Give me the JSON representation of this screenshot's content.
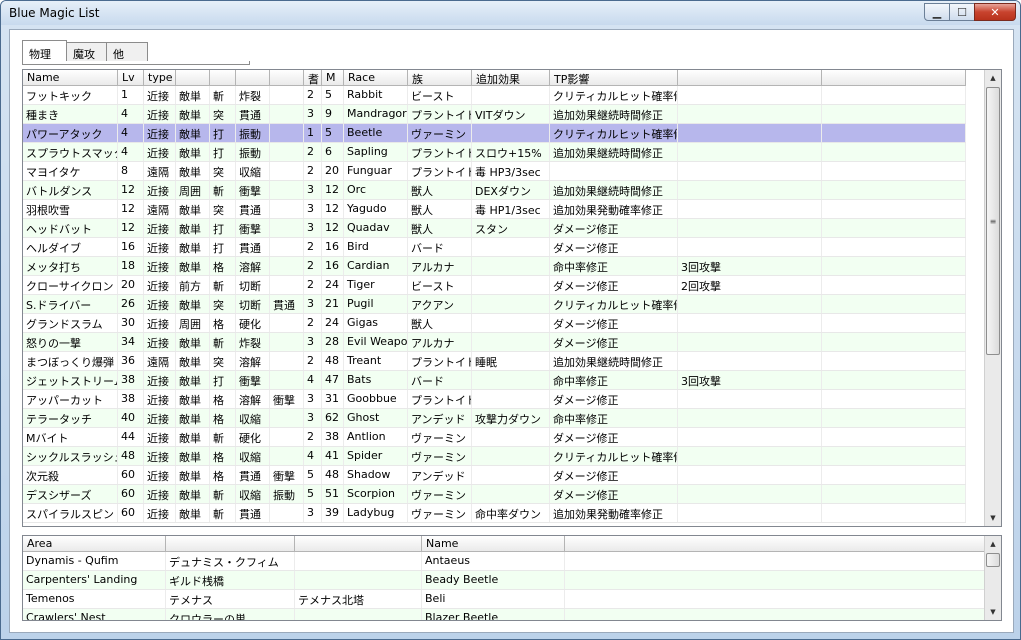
{
  "window": {
    "title": "Blue Magic List",
    "min": "▁",
    "max": "☐",
    "close": "✕"
  },
  "tabs": [
    "物理",
    "魔攻",
    "他"
  ],
  "spells": {
    "columns": [
      "Name",
      "Lv",
      "type",
      "",
      "",
      "",
      "",
      "耆",
      "M",
      "Race",
      "族",
      "追加効果",
      "TP影響",
      "",
      ""
    ],
    "selected_index": 2,
    "rows": [
      [
        "フットキック",
        "1",
        "近接",
        "敵単",
        "斬",
        "炸裂",
        "",
        "2",
        "5",
        "Rabbit",
        "ビースト",
        "",
        "クリティカルヒット確率修正",
        "",
        ""
      ],
      [
        "種まき",
        "4",
        "近接",
        "敵単",
        "突",
        "貫通",
        "",
        "3",
        "9",
        "Mandragora",
        "プラントイド",
        "VITダウン",
        "追加効果継続時間修正",
        "",
        ""
      ],
      [
        "パワーアタック",
        "4",
        "近接",
        "敵単",
        "打",
        "振動",
        "",
        "1",
        "5",
        "Beetle",
        "ヴァーミン",
        "",
        "クリティカルヒット確率修正",
        "",
        ""
      ],
      [
        "スプラウトスマック",
        "4",
        "近接",
        "敵単",
        "打",
        "振動",
        "",
        "2",
        "6",
        "Sapling",
        "プラントイド",
        "スロウ+15%",
        "追加効果継続時間修正",
        "",
        ""
      ],
      [
        "マヨイタケ",
        "8",
        "遠隔",
        "敵単",
        "突",
        "収縮",
        "",
        "2",
        "20",
        "Funguar",
        "プラントイド",
        "毒 HP3/3sec",
        "",
        "",
        ""
      ],
      [
        "バトルダンス",
        "12",
        "近接",
        "周囲",
        "斬",
        "衝撃",
        "",
        "3",
        "12",
        "Orc",
        "獣人",
        "DEXダウン",
        "追加効果継続時間修正",
        "",
        ""
      ],
      [
        "羽根吹雪",
        "12",
        "遠隔",
        "敵単",
        "突",
        "貫通",
        "",
        "3",
        "12",
        "Yagudo",
        "獣人",
        "毒 HP1/3sec",
        "追加効果発動確率修正",
        "",
        ""
      ],
      [
        "ヘッドバット",
        "12",
        "近接",
        "敵単",
        "打",
        "衝撃",
        "",
        "3",
        "12",
        "Quadav",
        "獣人",
        "スタン",
        "ダメージ修正",
        "",
        ""
      ],
      [
        "ヘルダイブ",
        "16",
        "近接",
        "敵単",
        "打",
        "貫通",
        "",
        "2",
        "16",
        "Bird",
        "バード",
        "",
        "ダメージ修正",
        "",
        ""
      ],
      [
        "メッタ打ち",
        "18",
        "近接",
        "敵単",
        "格",
        "溶解",
        "",
        "2",
        "16",
        "Cardian",
        "アルカナ",
        "",
        "命中率修正",
        "3回攻撃",
        ""
      ],
      [
        "クローサイクロン",
        "20",
        "近接",
        "前方",
        "斬",
        "切断",
        "",
        "2",
        "24",
        "Tiger",
        "ビースト",
        "",
        "ダメージ修正",
        "2回攻撃",
        ""
      ],
      [
        "S.ドライバー",
        "26",
        "近接",
        "敵単",
        "突",
        "切断",
        "貫通",
        "3",
        "21",
        "Pugil",
        "アクアン",
        "",
        "クリティカルヒット確率修正",
        "",
        ""
      ],
      [
        "グランドスラム",
        "30",
        "近接",
        "周囲",
        "格",
        "硬化",
        "",
        "2",
        "24",
        "Gigas",
        "獣人",
        "",
        "ダメージ修正",
        "",
        ""
      ],
      [
        "怒りの一撃",
        "34",
        "近接",
        "敵単",
        "斬",
        "炸裂",
        "",
        "3",
        "28",
        "Evil Weapon",
        "アルカナ",
        "",
        "ダメージ修正",
        "",
        ""
      ],
      [
        "まつぼっくり爆弾",
        "36",
        "遠隔",
        "敵単",
        "突",
        "溶解",
        "",
        "2",
        "48",
        "Treant",
        "プラントイド",
        "睡眠",
        "追加効果継続時間修正",
        "",
        ""
      ],
      [
        "ジェットストリーム",
        "38",
        "近接",
        "敵単",
        "打",
        "衝撃",
        "",
        "4",
        "47",
        "Bats",
        "バード",
        "",
        "命中率修正",
        "3回攻撃",
        ""
      ],
      [
        "アッパーカット",
        "38",
        "近接",
        "敵単",
        "格",
        "溶解",
        "衝撃",
        "3",
        "31",
        "Goobbue",
        "プラントイド",
        "",
        "ダメージ修正",
        "",
        ""
      ],
      [
        "テラータッチ",
        "40",
        "近接",
        "敵単",
        "格",
        "収縮",
        "",
        "3",
        "62",
        "Ghost",
        "アンデッド",
        "攻撃力ダウン",
        "命中率修正",
        "",
        ""
      ],
      [
        "Mバイト",
        "44",
        "近接",
        "敵単",
        "斬",
        "硬化",
        "",
        "2",
        "38",
        "Antlion",
        "ヴァーミン",
        "",
        "ダメージ修正",
        "",
        ""
      ],
      [
        "シックルスラッシュ",
        "48",
        "近接",
        "敵単",
        "格",
        "収縮",
        "",
        "4",
        "41",
        "Spider",
        "ヴァーミン",
        "",
        "クリティカルヒット確率修正",
        "",
        ""
      ],
      [
        "次元殺",
        "60",
        "近接",
        "敵単",
        "格",
        "貫通",
        "衝撃",
        "5",
        "48",
        "Shadow",
        "アンデッド",
        "",
        "ダメージ修正",
        "",
        ""
      ],
      [
        "デスシザーズ",
        "60",
        "近接",
        "敵単",
        "斬",
        "収縮",
        "振動",
        "5",
        "51",
        "Scorpion",
        "ヴァーミン",
        "",
        "ダメージ修正",
        "",
        ""
      ],
      [
        "スパイラルスピン",
        "60",
        "近接",
        "敵単",
        "斬",
        "貫通",
        "",
        "3",
        "39",
        "Ladybug",
        "ヴァーミン",
        "命中率ダウン",
        "追加効果発動確率修正",
        "",
        ""
      ]
    ]
  },
  "areas": {
    "columns": [
      "Area",
      "",
      "",
      "Name",
      ""
    ],
    "rows": [
      [
        "Dynamis - Qufim",
        "デュナミス・クフィム",
        "",
        "Antaeus",
        ""
      ],
      [
        "Carpenters' Landing",
        "ギルド桟橋",
        "",
        "Beady Beetle",
        ""
      ],
      [
        "Temenos",
        "テメナス",
        "テメナス北塔",
        "Beli",
        ""
      ],
      [
        "Crawlers' Nest",
        "クロウラーの巣",
        "",
        "Blazer Beetle",
        ""
      ]
    ]
  },
  "icons": {
    "scroll_up": "scroll-up-arrow-icon",
    "scroll_down": "scroll-down-arrow-icon"
  }
}
